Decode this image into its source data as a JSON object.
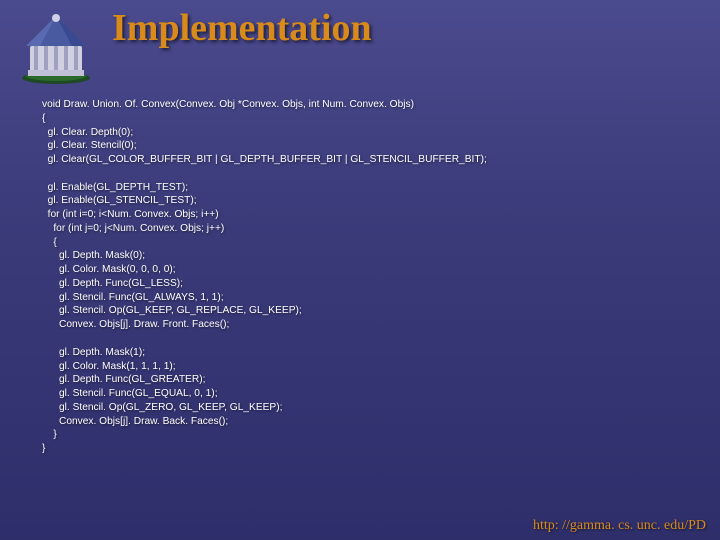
{
  "title": "Implementation",
  "footer": "http: //gamma. cs. unc. edu/PD",
  "code": "void Draw. Union. Of. Convex(Convex. Obj *Convex. Objs, int Num. Convex. Objs)\n{\n  gl. Clear. Depth(0);\n  gl. Clear. Stencil(0);\n  gl. Clear(GL_COLOR_BUFFER_BIT | GL_DEPTH_BUFFER_BIT | GL_STENCIL_BUFFER_BIT);\n\n  gl. Enable(GL_DEPTH_TEST);\n  gl. Enable(GL_STENCIL_TEST);\n  for (int i=0; i<Num. Convex. Objs; i++)\n    for (int j=0; j<Num. Convex. Objs; j++)\n    {\n      gl. Depth. Mask(0);\n      gl. Color. Mask(0, 0, 0, 0);\n      gl. Depth. Func(GL_LESS);\n      gl. Stencil. Func(GL_ALWAYS, 1, 1);\n      gl. Stencil. Op(GL_KEEP, GL_REPLACE, GL_KEEP);\n      Convex. Objs[j]. Draw. Front. Faces();\n\n      gl. Depth. Mask(1);\n      gl. Color. Mask(1, 1, 1, 1);\n      gl. Depth. Func(GL_GREATER);\n      gl. Stencil. Func(GL_EQUAL, 0, 1);\n      gl. Stencil. Op(GL_ZERO, GL_KEEP, GL_KEEP);\n      Convex. Objs[j]. Draw. Back. Faces();\n    }\n}"
}
